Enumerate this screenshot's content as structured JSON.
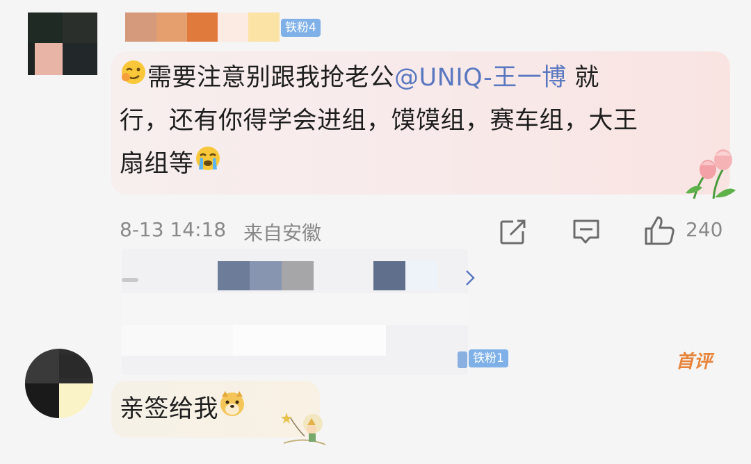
{
  "comment1": {
    "badge": "铁粉4",
    "text_line1_a": "需要注意别跟我抢老公",
    "mention": "@UNIQ-王一博",
    "text_line1_b": " 就",
    "text_line2": "行，还有你得学会进组，馍馍组，赛车组，大王",
    "text_line3": "扇组等",
    "time": "8-13 14:18",
    "location": "来自安徽",
    "likes": "240"
  },
  "comment2": {
    "badge": "铁粉1",
    "top_tag": "首评",
    "text": "亲签给我"
  },
  "icons": [
    "share-icon",
    "comment-icon",
    "like-icon",
    "chevron-right-icon",
    "tulip-sticker",
    "star-child-sticker",
    "doge-emoji",
    "wink-emoji",
    "cry-emoji"
  ],
  "colors": {
    "mention": "#5a78c0",
    "badge": "#7fb0e8",
    "top_tag": "#e8833a",
    "meta": "#888888"
  }
}
